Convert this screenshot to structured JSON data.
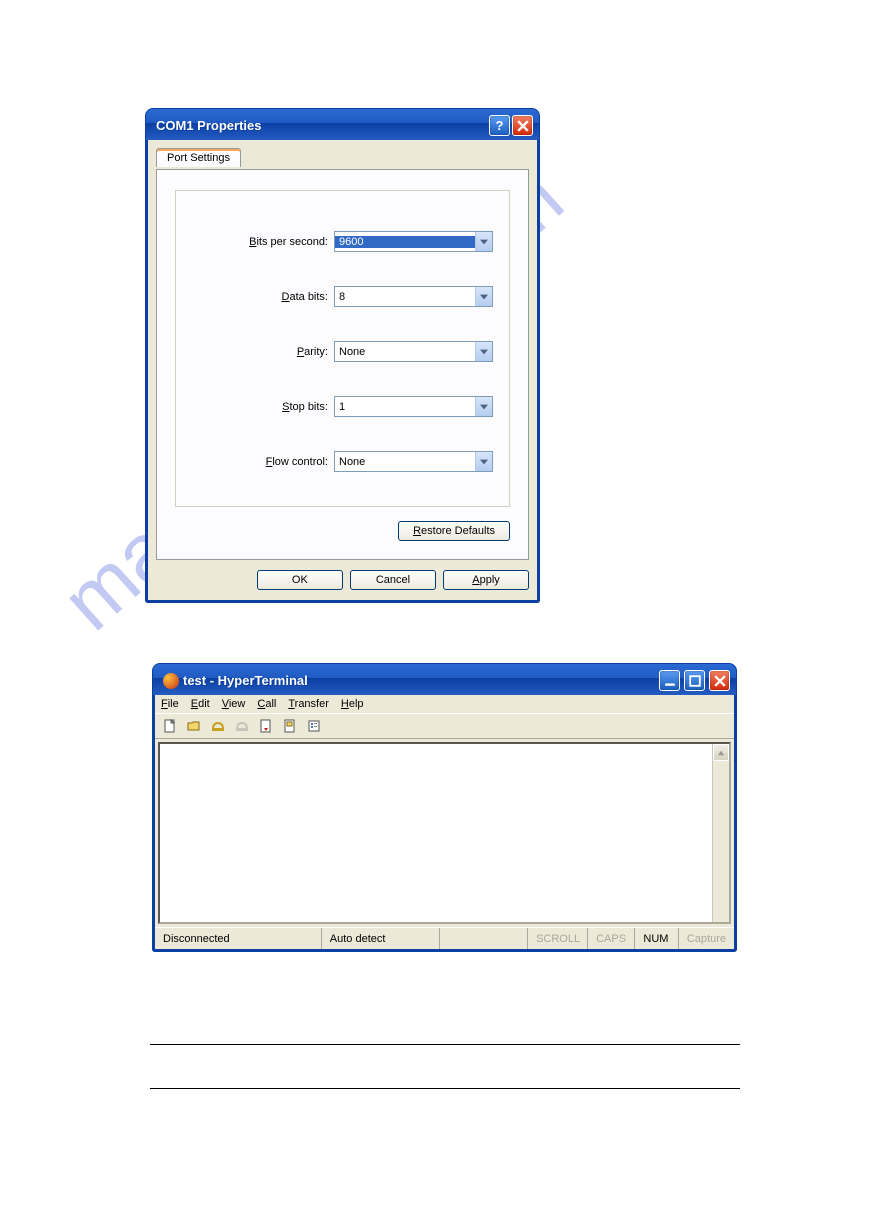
{
  "dialog1": {
    "title": "COM1 Properties",
    "tab_label": "Port Settings",
    "fields": {
      "bps": {
        "label_pre": "",
        "label_u": "B",
        "label_post": "its per second:",
        "value": "9600"
      },
      "databits": {
        "label_pre": "",
        "label_u": "D",
        "label_post": "ata bits:",
        "value": "8"
      },
      "parity": {
        "label_pre": "",
        "label_u": "P",
        "label_post": "arity:",
        "value": "None"
      },
      "stopbits": {
        "label_pre": "",
        "label_u": "S",
        "label_post": "top bits:",
        "value": "1"
      },
      "flow": {
        "label_pre": "",
        "label_u": "F",
        "label_post": "low control:",
        "value": "None"
      }
    },
    "restore_pre": "",
    "restore_u": "R",
    "restore_post": "estore Defaults",
    "ok": "OK",
    "cancel": "Cancel",
    "apply_u": "A",
    "apply_post": "pply"
  },
  "dialog2": {
    "title": "test - HyperTerminal",
    "menu": {
      "file_u": "F",
      "file_post": "ile",
      "edit_u": "E",
      "edit_post": "dit",
      "view_u": "V",
      "view_post": "iew",
      "call_u": "C",
      "call_post": "all",
      "transfer_u": "T",
      "transfer_post": "ransfer",
      "help_u": "H",
      "help_post": "elp"
    },
    "status": {
      "conn": "Disconnected",
      "detect": "Auto detect",
      "scroll": "SCROLL",
      "caps": "CAPS",
      "num": "NUM",
      "capture": "Capture"
    }
  },
  "watermark": "manualshive.com"
}
